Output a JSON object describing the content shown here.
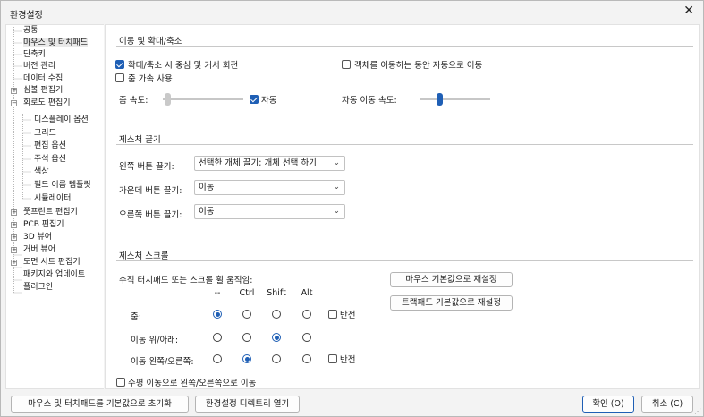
{
  "window": {
    "title": "환경설정",
    "close_glyph": "✕"
  },
  "tree": {
    "items": [
      {
        "label": "공통"
      },
      {
        "label": "마우스 및 터치패드"
      },
      {
        "label": "단축키"
      },
      {
        "label": "버전 관리"
      },
      {
        "label": "데이터 수집"
      },
      {
        "label": "심볼 편집기"
      },
      {
        "label": "회로도 편집기"
      },
      {
        "label": "디스플레이 옵션"
      },
      {
        "label": "그리드"
      },
      {
        "label": "편집 옵션"
      },
      {
        "label": "주석 옵션"
      },
      {
        "label": "색상"
      },
      {
        "label": "필드 이름 템플릿"
      },
      {
        "label": "시뮬레이터"
      },
      {
        "label": "풋프린트 편집기"
      },
      {
        "label": "PCB 편집기"
      },
      {
        "label": "3D 뷰어"
      },
      {
        "label": "거버 뷰어"
      },
      {
        "label": "도면 시트 편집기"
      },
      {
        "label": "패키지와 업데이트"
      },
      {
        "label": "플러그인"
      }
    ],
    "expand_plus": "+",
    "expand_minus": "−"
  },
  "pan_zoom": {
    "title": "이동 및 확대/축소",
    "center_warp": {
      "label": "확대/축소 시 중심 및 커서 회전",
      "checked": true
    },
    "auto_pan_move": {
      "label": "객체를 이동하는 동안 자동으로 이동",
      "checked": false
    },
    "zoom_accel": {
      "label": "줌 가속 사용",
      "checked": false
    },
    "zoom_speed_label": "줌 속도:",
    "zoom_speed_value": 0.05,
    "auto_label": "자동",
    "auto_checked": true,
    "auto_pan_speed_label": "자동 이동 속도:",
    "auto_pan_speed_value": 0.27
  },
  "drag": {
    "title": "제스처 끌기",
    "left_label": "왼쪽 버튼 끌기:",
    "left_value": "선택한 개체 끌기; 개체 선택 하기",
    "middle_label": "가운데 버튼 끌기:",
    "middle_value": "이동",
    "right_label": "오른쪽 버튼 끌기:",
    "right_value": "이동"
  },
  "scroll": {
    "title": "제스처 스크롤",
    "vertical_label": "수직 터치패드 또는 스크롤 휠 움직임:",
    "columns": [
      "--",
      "Ctrl",
      "Shift",
      "Alt"
    ],
    "rows": [
      {
        "label": "줌:",
        "selected": 0,
        "invert_label": "반전"
      },
      {
        "label": "이동 위/아래:",
        "selected": 2
      },
      {
        "label": "이동 왼쪽/오른쪽:",
        "selected": 1,
        "invert_label": "반전"
      }
    ],
    "horizontal_pan": {
      "label": "수평 이동으로 왼쪽/오른쪽으로 이동",
      "checked": false
    },
    "reset_mouse": "마우스 기본값으로 재설정",
    "reset_trackpad": "트랙패드 기본값으로 재설정"
  },
  "footer": {
    "reset_mouse_trackpad": "마우스 및 터치패드를 기본값으로 초기화",
    "open_dir": "환경설정 디렉토리 열기",
    "ok": "확인 (O)",
    "cancel": "취소 (C)"
  },
  "colors": {
    "accent": "#1f5fb5"
  }
}
